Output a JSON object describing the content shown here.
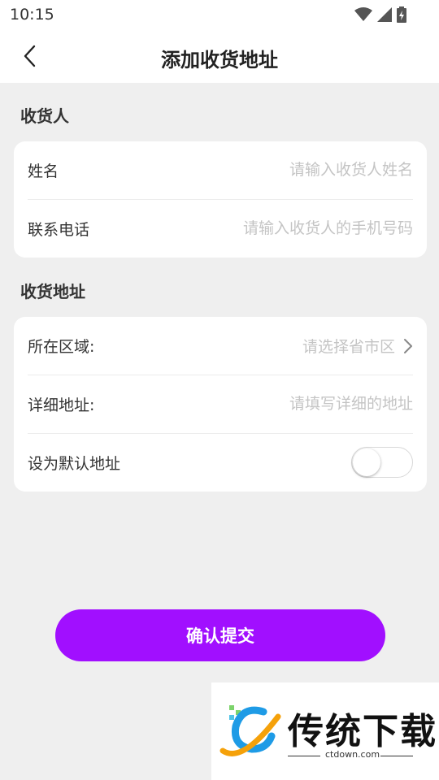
{
  "status_bar": {
    "time": "10:15"
  },
  "header": {
    "title": "添加收货地址"
  },
  "sections": {
    "receiver": "收货人",
    "address": "收货地址"
  },
  "receiver_card": {
    "name_label": "姓名",
    "name_placeholder": "请输入收货人姓名",
    "phone_label": "联系电话",
    "phone_placeholder": "请输入收货人的手机号码"
  },
  "address_card": {
    "region_label": "所在区域:",
    "region_placeholder": "请选择省市区",
    "detail_label": "详细地址:",
    "detail_placeholder": "请填写详细的地址",
    "default_label": "设为默认地址",
    "default_enabled": false
  },
  "submit_label": "确认提交",
  "watermark": {
    "text": "传统下载",
    "url": "ctdown.com"
  },
  "colors": {
    "accent": "#a10fff",
    "background": "#efefef",
    "card": "#ffffff"
  }
}
